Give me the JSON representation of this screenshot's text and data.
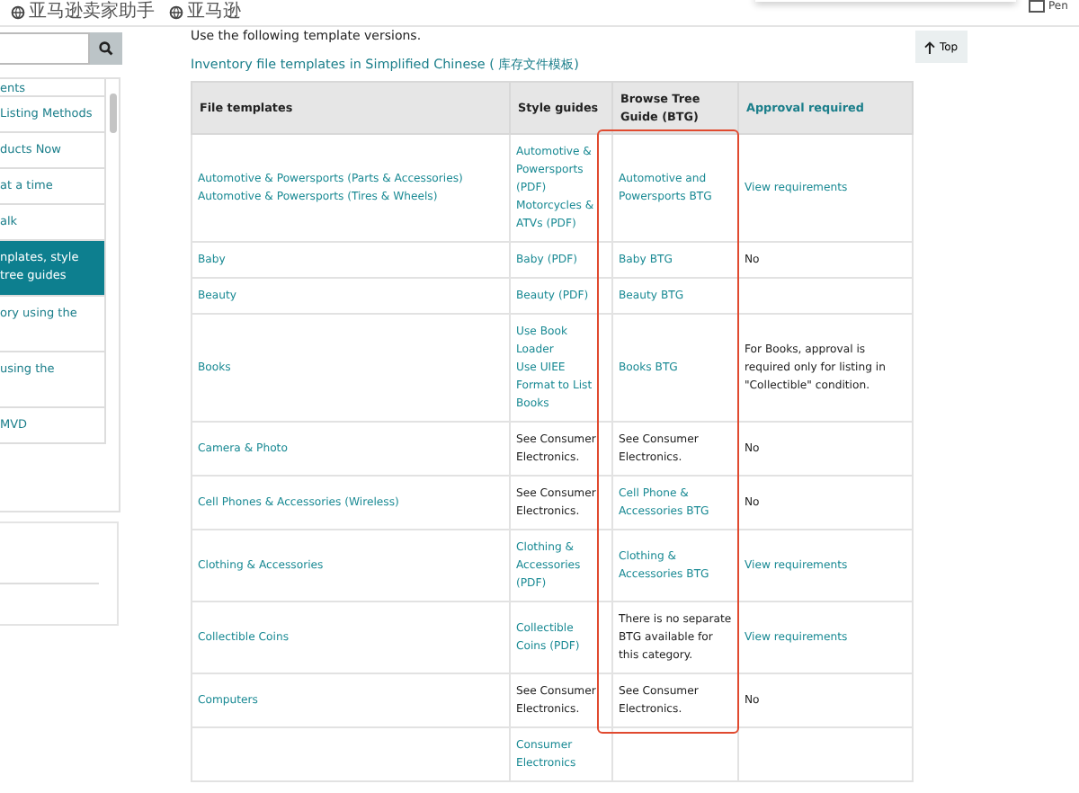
{
  "bookmarks": [
    "亚马逊卖家助手",
    "亚马逊"
  ],
  "bookmark_right": "Pen",
  "sidebar": {
    "items": [
      {
        "label": "ents",
        "selected": false
      },
      {
        "label": "Listing Methods",
        "selected": false
      },
      {
        "label": "ducts Now",
        "selected": false
      },
      {
        "label": "at a time",
        "selected": false
      },
      {
        "label": "alk",
        "selected": false
      },
      {
        "label": "nplates, style tree guides",
        "selected": true
      },
      {
        "label": "ory using the",
        "selected": false
      },
      {
        "label": "using the",
        "selected": false
      },
      {
        "label": "MVD",
        "selected": false
      }
    ]
  },
  "intro": "Use the following template versions.",
  "chinese_link": "Inventory file templates in Simplified Chinese ( 库存文件模板)",
  "top_button": "Top",
  "table": {
    "columns": [
      {
        "label": "File templates",
        "kind": "text"
      },
      {
        "label": "Style guides",
        "kind": "text"
      },
      {
        "label": "Browse Tree Guide (BTG)",
        "kind": "text"
      },
      {
        "label": "Approval required",
        "kind": "link"
      }
    ],
    "rows": [
      [
        [
          {
            "kind": "link",
            "text": "Automotive & Powersports (Parts & Accessories)"
          },
          {
            "kind": "link",
            "text": "Automotive & Powersports (Tires & Wheels)"
          }
        ],
        [
          {
            "kind": "link",
            "text": "Automotive & Powersports (PDF)"
          },
          {
            "kind": "link",
            "text": "Motorcycles & ATVs (PDF)"
          }
        ],
        [
          {
            "kind": "link",
            "text": "Automotive and Powersports BTG"
          }
        ],
        [
          {
            "kind": "link",
            "text": "View requirements"
          }
        ]
      ],
      [
        [
          {
            "kind": "link",
            "text": "Baby"
          }
        ],
        [
          {
            "kind": "link",
            "text": "Baby (PDF)"
          }
        ],
        [
          {
            "kind": "link",
            "text": "Baby BTG"
          }
        ],
        [
          {
            "kind": "text",
            "text": "No"
          }
        ]
      ],
      [
        [
          {
            "kind": "link",
            "text": "Beauty"
          }
        ],
        [
          {
            "kind": "link",
            "text": "Beauty (PDF)"
          }
        ],
        [
          {
            "kind": "link",
            "text": "Beauty BTG"
          }
        ],
        []
      ],
      [
        [
          {
            "kind": "link",
            "text": "Books"
          }
        ],
        [
          {
            "kind": "link",
            "text": "Use Book Loader"
          },
          {
            "kind": "link",
            "text": "Use UIEE Format to List Books"
          }
        ],
        [
          {
            "kind": "link",
            "text": "Books BTG"
          }
        ],
        [
          {
            "kind": "text",
            "text": "For Books, approval is required only for listing in \"Collectible\" condition."
          }
        ]
      ],
      [
        [
          {
            "kind": "link",
            "text": "Camera & Photo"
          }
        ],
        [
          {
            "kind": "text",
            "text": "See Consumer Electronics."
          }
        ],
        [
          {
            "kind": "text",
            "text": "See Consumer Electronics."
          }
        ],
        [
          {
            "kind": "text",
            "text": "No"
          }
        ]
      ],
      [
        [
          {
            "kind": "link",
            "text": "Cell Phones & Accessories (Wireless)"
          }
        ],
        [
          {
            "kind": "text",
            "text": "See Consumer Electronics."
          }
        ],
        [
          {
            "kind": "link",
            "text": "Cell Phone & Accessories BTG"
          }
        ],
        [
          {
            "kind": "text",
            "text": "No"
          }
        ]
      ],
      [
        [
          {
            "kind": "link",
            "text": "Clothing & Accessories"
          }
        ],
        [
          {
            "kind": "link",
            "text": "Clothing & Accessories (PDF)"
          }
        ],
        [
          {
            "kind": "link",
            "text": "Clothing & Accessories BTG"
          }
        ],
        [
          {
            "kind": "link",
            "text": "View requirements"
          }
        ]
      ],
      [
        [
          {
            "kind": "link",
            "text": "Collectible Coins"
          }
        ],
        [
          {
            "kind": "link",
            "text": "Collectible Coins (PDF)"
          }
        ],
        [
          {
            "kind": "text",
            "text": "There is no separate BTG available for this category."
          }
        ],
        [
          {
            "kind": "link",
            "text": "View requirements"
          }
        ]
      ],
      [
        [
          {
            "kind": "link",
            "text": "Computers"
          }
        ],
        [
          {
            "kind": "text",
            "text": "See Consumer Electronics."
          }
        ],
        [
          {
            "kind": "text",
            "text": "See Consumer Electronics."
          }
        ],
        [
          {
            "kind": "text",
            "text": "No"
          }
        ]
      ],
      [
        [],
        [
          {
            "kind": "link",
            "text": "Consumer Electronics"
          }
        ],
        [],
        []
      ]
    ]
  }
}
